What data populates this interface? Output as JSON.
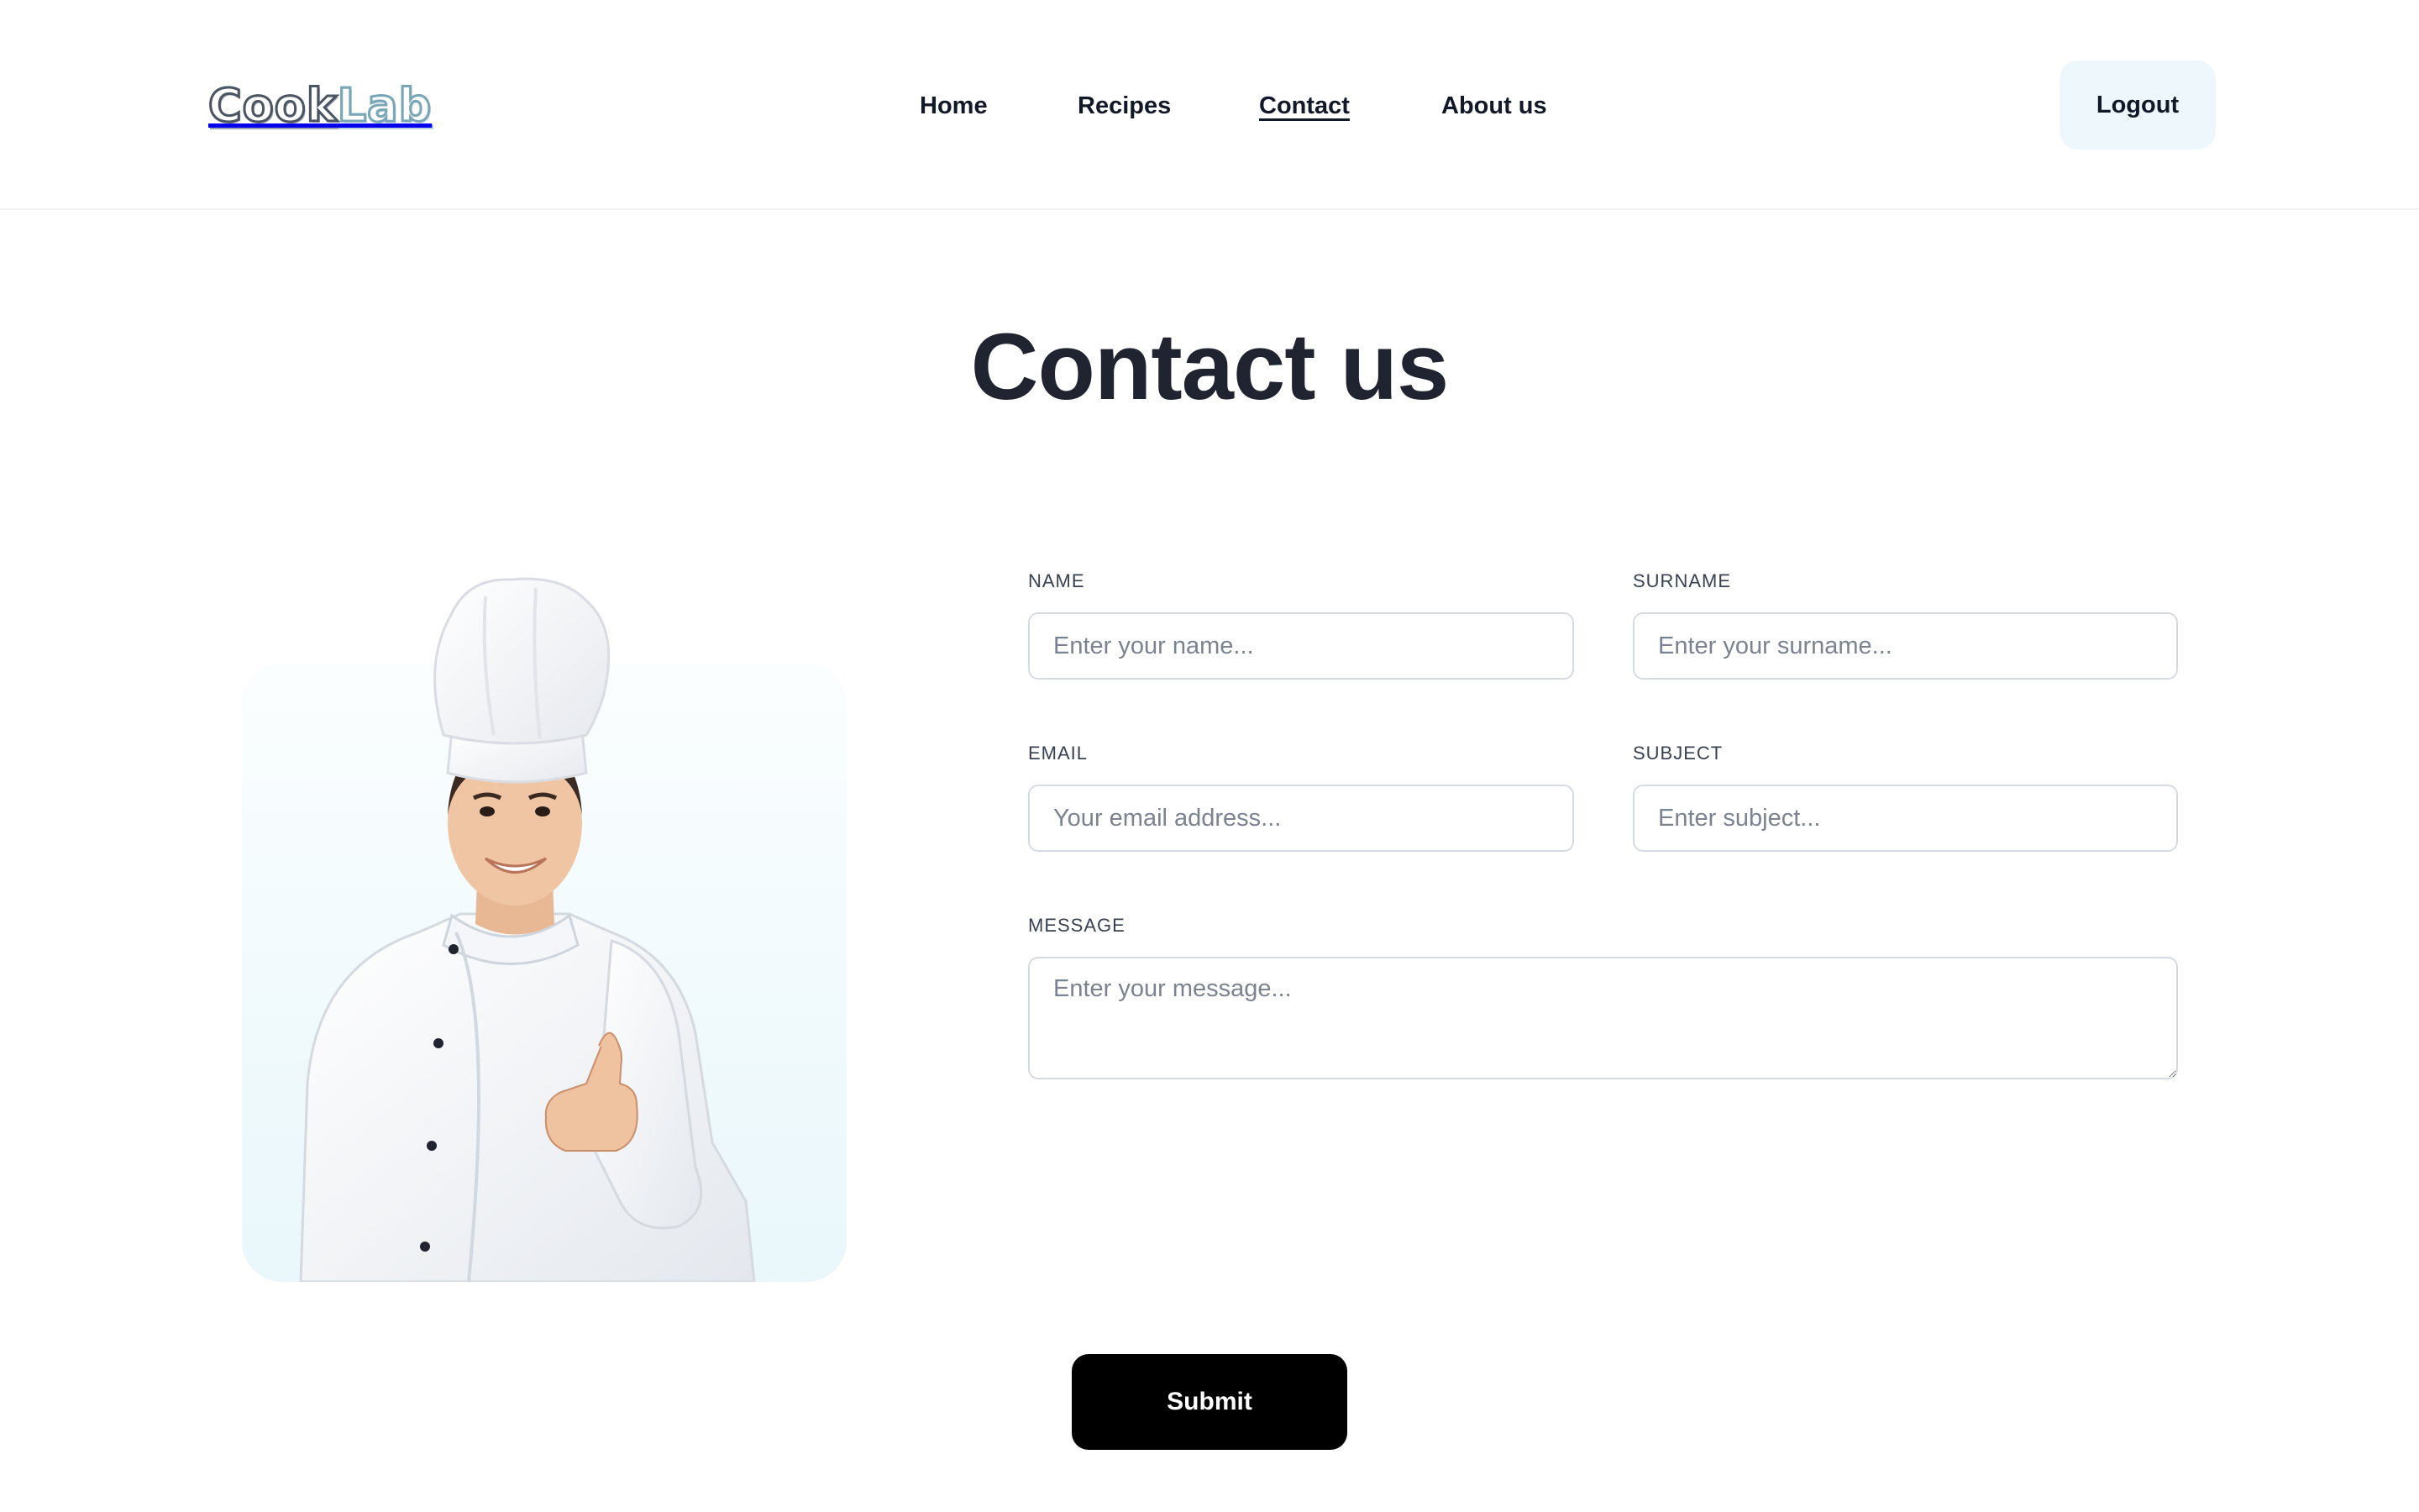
{
  "header": {
    "logo_part1": "Cook",
    "logo_part2": "Lab",
    "nav": [
      {
        "label": "Home"
      },
      {
        "label": "Recipes"
      },
      {
        "label": "Contact",
        "active": true
      },
      {
        "label": "About us"
      }
    ],
    "logout_label": "Logout"
  },
  "page": {
    "title": "Contact us"
  },
  "form": {
    "name": {
      "label": "NAME",
      "placeholder": "Enter your name..."
    },
    "surname": {
      "label": "SURNAME",
      "placeholder": "Enter your surname..."
    },
    "email": {
      "label": "EMAIL",
      "placeholder": "Your email address..."
    },
    "subject": {
      "label": "SUBJECT",
      "placeholder": "Enter subject..."
    },
    "message": {
      "label": "MESSAGE",
      "placeholder": "Enter your message..."
    },
    "submit_label": "Submit"
  },
  "colors": {
    "logout_bg": "#eef8fc",
    "submit_bg": "#000000",
    "title": "#1f2430",
    "card_gradient_end": "#e9f7fb"
  },
  "illustration": {
    "icon": "chef-thumbs-up-illustration"
  }
}
